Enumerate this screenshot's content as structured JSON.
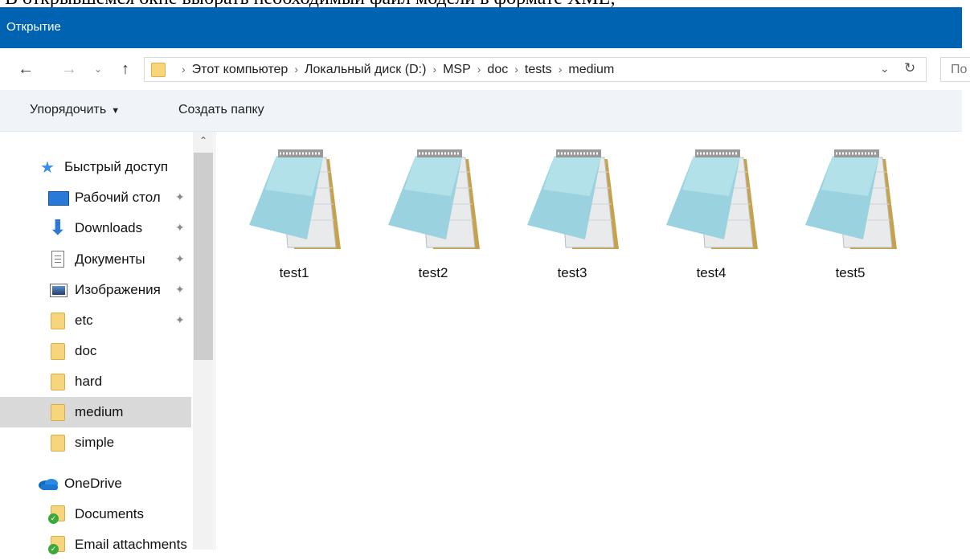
{
  "caption_text": "В открывшемся окне выбрать необходимый файл модели в формате XML;",
  "window": {
    "title": "Открытие"
  },
  "address": {
    "crumbs": [
      "Этот компьютер",
      "Локальный диск (D:)",
      "MSP",
      "doc",
      "tests",
      "medium"
    ],
    "search_placeholder": "По"
  },
  "toolbar": {
    "organize_label": "Упорядочить",
    "new_folder_label": "Создать папку"
  },
  "nav": {
    "quick_access": "Быстрый доступ",
    "items": [
      {
        "label": "Рабочий стол",
        "icon": "desktop-icon",
        "pinned": true
      },
      {
        "label": "Downloads",
        "icon": "download-arrow-icon",
        "pinned": true
      },
      {
        "label": "Документы",
        "icon": "document-icon",
        "pinned": true
      },
      {
        "label": "Изображения",
        "icon": "image-icon",
        "pinned": true
      },
      {
        "label": "etc",
        "icon": "folder-icon",
        "pinned": true
      },
      {
        "label": "doc",
        "icon": "folder-icon",
        "pinned": false
      },
      {
        "label": "hard",
        "icon": "folder-icon",
        "pinned": false
      },
      {
        "label": "medium",
        "icon": "folder-icon",
        "pinned": false,
        "selected": true
      },
      {
        "label": "simple",
        "icon": "folder-icon",
        "pinned": false
      }
    ],
    "onedrive": "OneDrive",
    "onedrive_items": [
      {
        "label": "Documents",
        "icon": "synced-folder-icon"
      },
      {
        "label": "Email attachments",
        "icon": "synced-folder-icon"
      }
    ]
  },
  "files": [
    {
      "name": "test1",
      "icon": "notepad-icon"
    },
    {
      "name": "test2",
      "icon": "notepad-icon"
    },
    {
      "name": "test3",
      "icon": "notepad-icon"
    },
    {
      "name": "test4",
      "icon": "notepad-icon"
    },
    {
      "name": "test5",
      "icon": "notepad-icon"
    }
  ],
  "colors": {
    "titlebar": "#0063b1",
    "selection": "#d9d9d9",
    "toolbar": "#f0f4f9"
  }
}
